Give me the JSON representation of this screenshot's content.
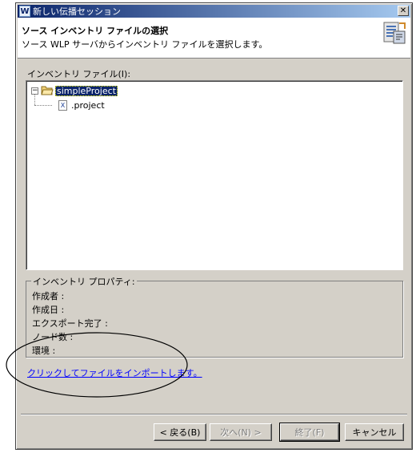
{
  "window": {
    "title": "新しい伝播セッション",
    "close_glyph": "✕"
  },
  "banner": {
    "title": "ソース インベントリ ファイルの選択",
    "description": "ソース WLP サーバからインベントリ ファイルを選択します。"
  },
  "inventory": {
    "label": "インベントリ ファイル(I):",
    "tree": [
      {
        "label": "simpleProject",
        "type": "folder",
        "expanded": true,
        "selected": true,
        "expander": "−"
      },
      {
        "label": ".project",
        "type": "file",
        "icon_glyph": "X"
      }
    ]
  },
  "properties": {
    "legend": "インベントリ プロパティ:",
    "items": [
      {
        "label": "作成者 :"
      },
      {
        "label": "作成日 :"
      },
      {
        "label": "エクスポート完了 :"
      },
      {
        "label": "ノード数 :"
      },
      {
        "label": "環境 :"
      }
    ]
  },
  "import_link": "クリックしてファイルをインポートします。",
  "buttons": {
    "back": "< 戻る(B)",
    "next": "次へ(N) >",
    "finish": "終了(F)",
    "cancel": "キャンセル"
  },
  "app_icon_glyph": "W",
  "colors": {
    "title_bar_start": "#0a246a",
    "title_bar_end": "#a6caf0",
    "dialog_face": "#d4d0c8",
    "selection": "#0a246a",
    "link": "#0000ff"
  }
}
